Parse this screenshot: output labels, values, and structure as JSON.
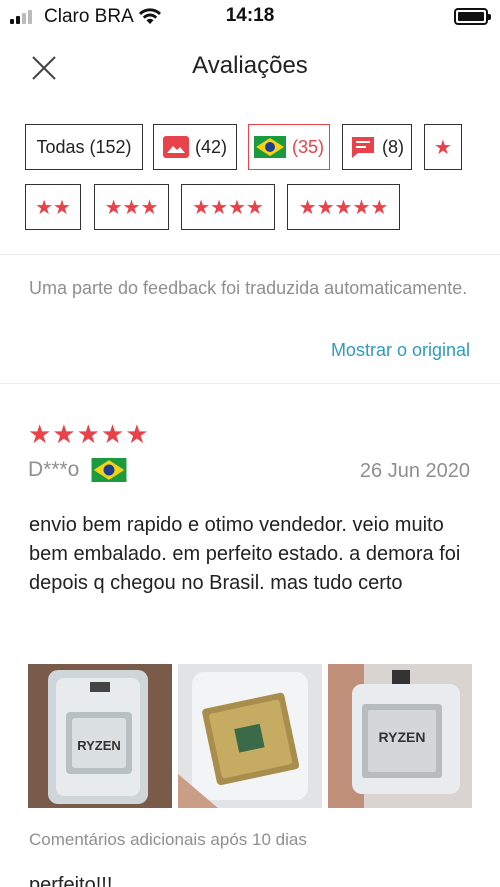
{
  "status_bar": {
    "carrier": "Claro BRA",
    "time": "14:18"
  },
  "header": {
    "title": "Avaliações"
  },
  "filters": [
    {
      "label": "Todas (152)",
      "icon": null,
      "active": false
    },
    {
      "label": "(42)",
      "icon": "photo-icon",
      "active": false
    },
    {
      "label": "(35)",
      "icon": "brazil-flag-icon",
      "active": true
    },
    {
      "label": "(8)",
      "icon": "comment-icon",
      "active": false
    },
    {
      "label": "★",
      "icon": null,
      "active": false
    },
    {
      "label": "★★",
      "icon": null,
      "active": false
    },
    {
      "label": "★★★",
      "icon": null,
      "active": false
    },
    {
      "label": "★★★★",
      "icon": null,
      "active": false
    },
    {
      "label": "★★★★★",
      "icon": null,
      "active": false
    }
  ],
  "translation": {
    "note": "Uma parte do feedback foi traduzida automaticamente.",
    "show_original": "Mostrar o original"
  },
  "review": {
    "rating": 5,
    "stars": "★★★★★",
    "reviewer": "D***o",
    "country_flag": "brazil-flag-icon",
    "date": "26 Jun 2020",
    "text": "envio bem rapido e otimo vendedor. veio muito bem embalado. em perfeito estado. a demora foi depois q chegou no Brasil. mas tudo certo",
    "photos": [
      {
        "icon": "product-photo-ryzen-box",
        "label": "RYZEN"
      },
      {
        "icon": "product-photo-cpu-pins",
        "label": ""
      },
      {
        "icon": "product-photo-ryzen-chip",
        "label": "RYZEN"
      }
    ],
    "additional_label": "Comentários adicionais após 10 dias",
    "additional_text": "perfeito!!!"
  },
  "colors": {
    "accent": "#e8434a",
    "link": "#2f9bbf",
    "muted": "#8f8f8f"
  }
}
